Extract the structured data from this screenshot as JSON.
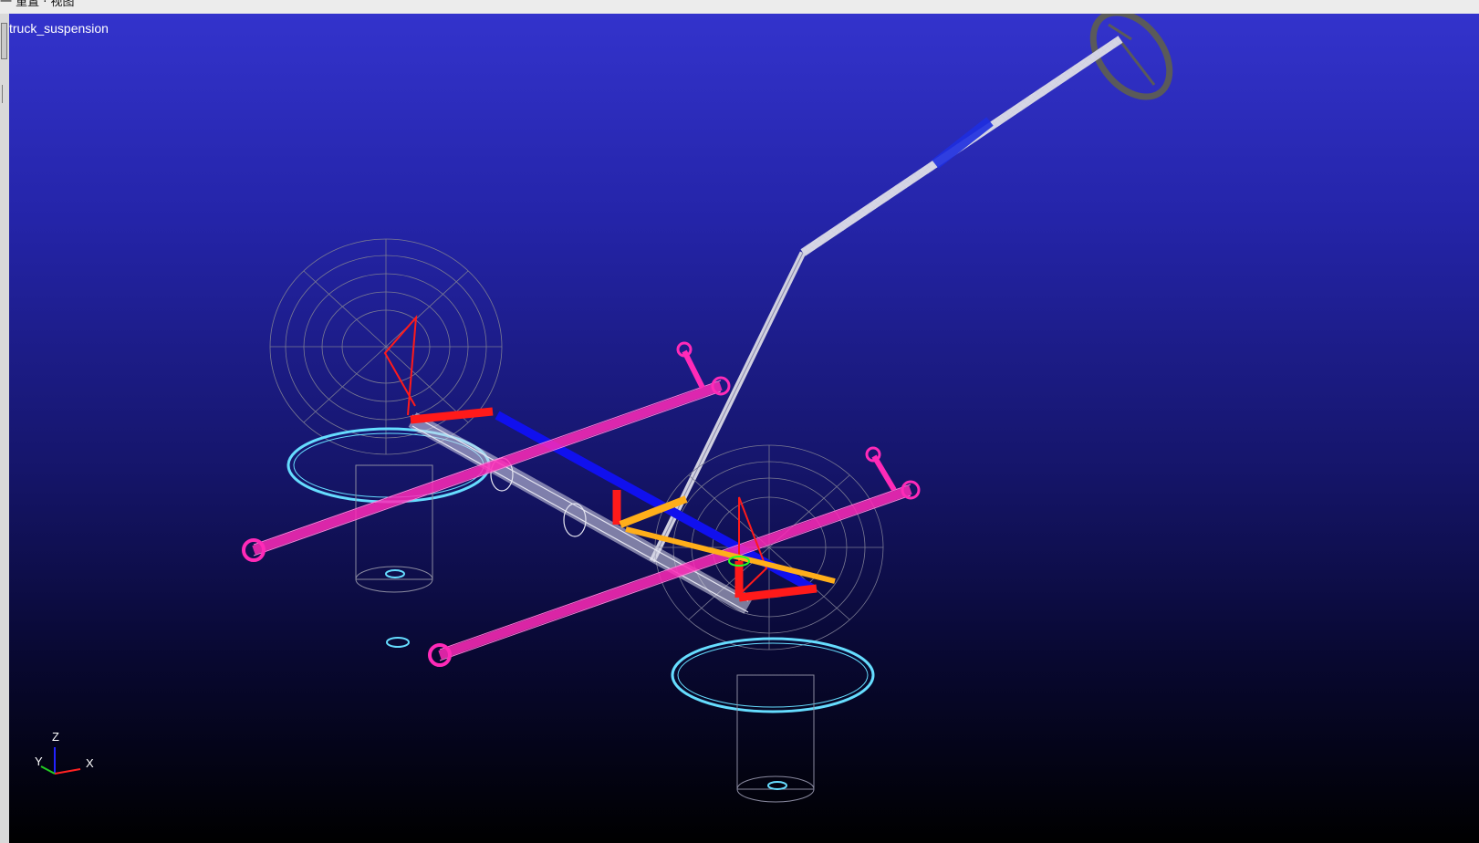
{
  "window": {
    "menu_fragment": "一 重置 · 视图"
  },
  "viewport": {
    "model_name": "truck_suspension",
    "background_top": "#3333cc",
    "background_bottom": "#000000"
  },
  "triad": {
    "z_label": "Z",
    "y_label": "Y",
    "x_label": "X"
  },
  "parts": [
    {
      "name": "steering-wheel",
      "color": "#5a5a5a"
    },
    {
      "name": "steering-column",
      "color": "#cfcfe0"
    },
    {
      "name": "leaf-springs",
      "color": "#ff2ab8"
    },
    {
      "name": "axle-beam",
      "color": "#d8d8e8"
    },
    {
      "name": "tie-rod",
      "color": "#1010ee"
    },
    {
      "name": "steering-arms",
      "color": "#ff1a1a"
    },
    {
      "name": "drag-link",
      "color": "#ffae1a"
    },
    {
      "name": "wheels",
      "color": "#8a8aa0"
    },
    {
      "name": "ground-patches",
      "color": "#66ddff"
    }
  ]
}
